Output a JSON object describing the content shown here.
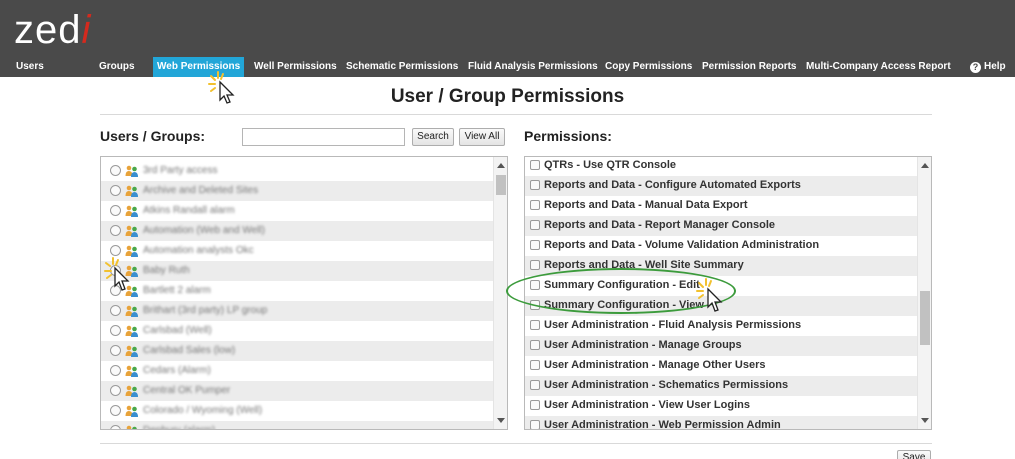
{
  "brand": {
    "logo_main": "zed",
    "logo_accent": "i",
    "accent_color": "#d42a1e",
    "header_bg": "#4a4a4a",
    "active_tab_color": "#22a6d8"
  },
  "nav": {
    "items": [
      {
        "label": "Users"
      },
      {
        "label": "Groups"
      },
      {
        "label": "Web Permissions",
        "active": true
      },
      {
        "label": "Well Permissions"
      },
      {
        "label": "Schematic Permissions"
      },
      {
        "label": "Fluid Analysis Permissions"
      },
      {
        "label": "Copy Permissions"
      },
      {
        "label": "Permission Reports"
      },
      {
        "label": "Multi-Company Access Report"
      }
    ],
    "help_label": "Help"
  },
  "page": {
    "title": "User / Group Permissions"
  },
  "users_panel": {
    "heading": "Users / Groups:",
    "search_value": "",
    "search_button": "Search",
    "view_all_button": "View All",
    "items": [
      "3rd Party access",
      "Archive and Deleted Sites",
      "Atkins Randall alarm",
      "Automation (Web and Well)",
      "Automation analysts Okc",
      "Baby Ruth",
      "Bartlett 2 alarm",
      "Brithart (3rd party) LP group",
      "Carlsbad (Well)",
      "Carlsbad Sales (low)",
      "Cedars (Alarm)",
      "Central OK Pumper",
      "Colorado / Wyoming (Well)",
      "Denbury (alarm)"
    ]
  },
  "permissions_panel": {
    "heading": "Permissions:",
    "items": [
      "QTRs - Use QTR Console",
      "Reports and Data - Configure Automated Exports",
      "Reports and Data - Manual Data Export",
      "Reports and Data - Report Manager Console",
      "Reports and Data - Volume Validation Administration",
      "Reports and Data - Well Site Summary",
      "Summary Configuration - Edit",
      "Summary Configuration - View",
      "User Administration - Fluid Analysis Permissions",
      "User Administration - Manage Groups",
      "User Administration - Manage Other Users",
      "User Administration - Schematics Permissions",
      "User Administration - View User Logins",
      "User Administration - Web Permission Admin"
    ]
  },
  "footer": {
    "save_button": "Save"
  }
}
